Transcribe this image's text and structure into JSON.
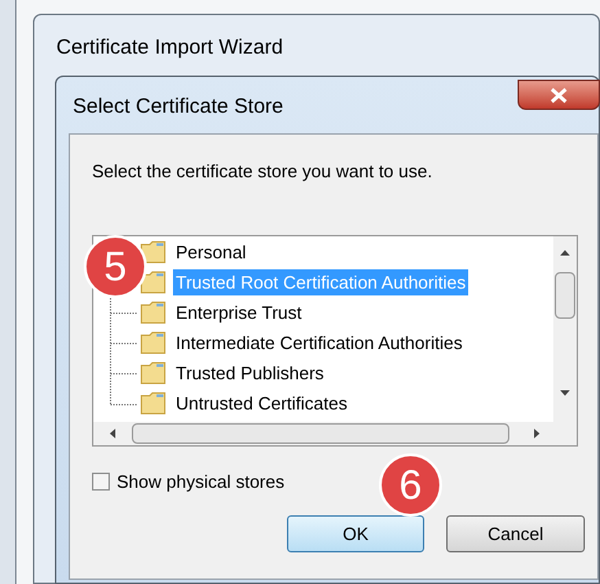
{
  "background_window": {
    "title": "Certificate Import Wizard"
  },
  "dialog": {
    "title": "Select Certificate Store",
    "prompt": "Select the certificate store you want to use.",
    "stores": [
      {
        "label": "Personal",
        "selected": false
      },
      {
        "label": "Trusted Root Certification Authorities",
        "selected": true
      },
      {
        "label": "Enterprise Trust",
        "selected": false
      },
      {
        "label": "Intermediate Certification Authorities",
        "selected": false
      },
      {
        "label": "Trusted Publishers",
        "selected": false
      },
      {
        "label": "Untrusted Certificates",
        "selected": false
      }
    ],
    "show_physical_stores": {
      "label": "Show physical stores",
      "checked": false
    },
    "buttons": [
      {
        "label": "OK",
        "default": true
      },
      {
        "label": "Cancel",
        "default": false
      }
    ]
  },
  "callouts": [
    {
      "number": "5"
    },
    {
      "number": "6"
    }
  ]
}
